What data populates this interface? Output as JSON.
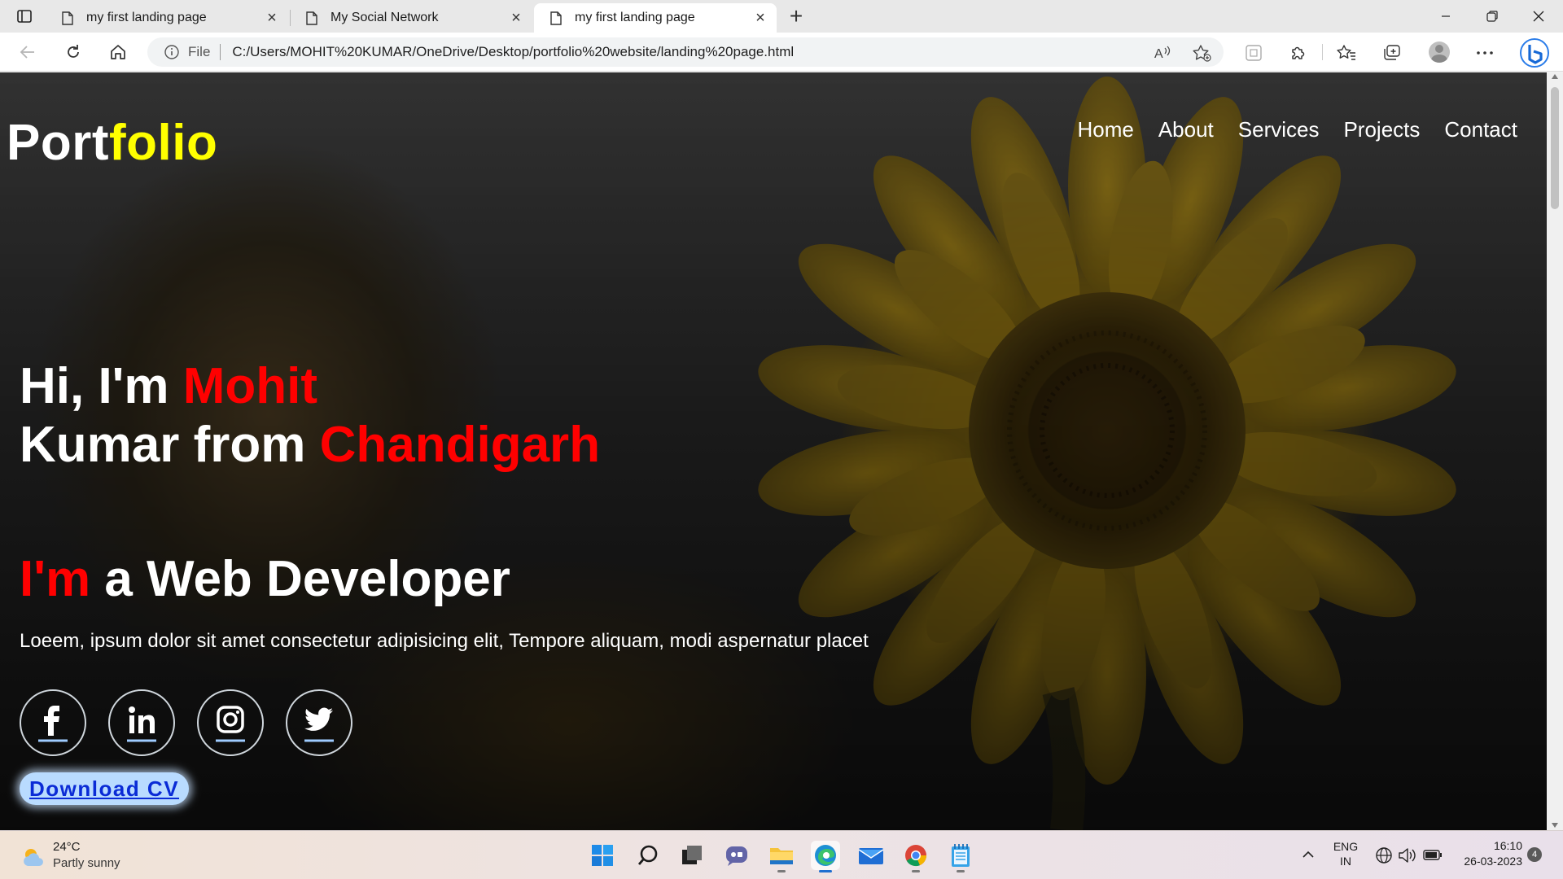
{
  "browser": {
    "tabs": [
      {
        "title": "my first landing page",
        "active": false
      },
      {
        "title": "My Social Network",
        "active": false
      },
      {
        "title": "my first landing page",
        "active": true
      }
    ],
    "address": {
      "scheme_label": "File",
      "url": "C:/Users/MOHIT%20KUMAR/OneDrive/Desktop/portfolio%20website/landing%20page.html"
    },
    "icons": [
      "tab-actions-icon",
      "page-icon",
      "close-icon",
      "plus-icon",
      "minimize-icon",
      "restore-icon",
      "back-icon",
      "refresh-icon",
      "home-icon",
      "info-icon",
      "read-aloud-icon",
      "add-favorite-icon",
      "split-screen-icon",
      "extensions-icon",
      "favorites-icon",
      "collections-icon",
      "profile-icon",
      "more-icon",
      "bing-icon"
    ]
  },
  "page": {
    "logo": {
      "part1": "Port",
      "part2": "folio"
    },
    "nav": [
      "Home",
      "About",
      "Services",
      "Projects",
      "Contact"
    ],
    "intro": {
      "line1_prefix": "Hi, I'm ",
      "line1_highlight": "Mohit",
      "line2_prefix": "Kumar from ",
      "line2_highlight": "Chandigarh"
    },
    "role": {
      "highlight": "I'm",
      "rest": " a Web Developer"
    },
    "description": "Loeem, ipsum dolor sit amet consectetur adipisicing elit, Tempore aliquam, modi aspernatur placet",
    "socials": [
      "facebook-icon",
      "linkedin-icon",
      "instagram-icon",
      "twitter-icon"
    ],
    "cv_button": "Download CV",
    "colors": {
      "logo_accent": "#ffff00",
      "highlight": "#ff0000",
      "cv_bg": "#b9dbff",
      "cv_text": "#0a2bd6"
    }
  },
  "taskbar": {
    "weather": {
      "temp": "24°C",
      "desc": "Partly sunny"
    },
    "apps": [
      "start-icon",
      "search-icon",
      "task-view-icon",
      "chat-icon",
      "file-explorer-icon",
      "edge-icon",
      "mail-icon",
      "chrome-icon",
      "notepad-icon"
    ],
    "tray": {
      "lang_line1": "ENG",
      "lang_line2": "IN",
      "time": "16:10",
      "date": "26-03-2023",
      "notifications": "4"
    }
  }
}
